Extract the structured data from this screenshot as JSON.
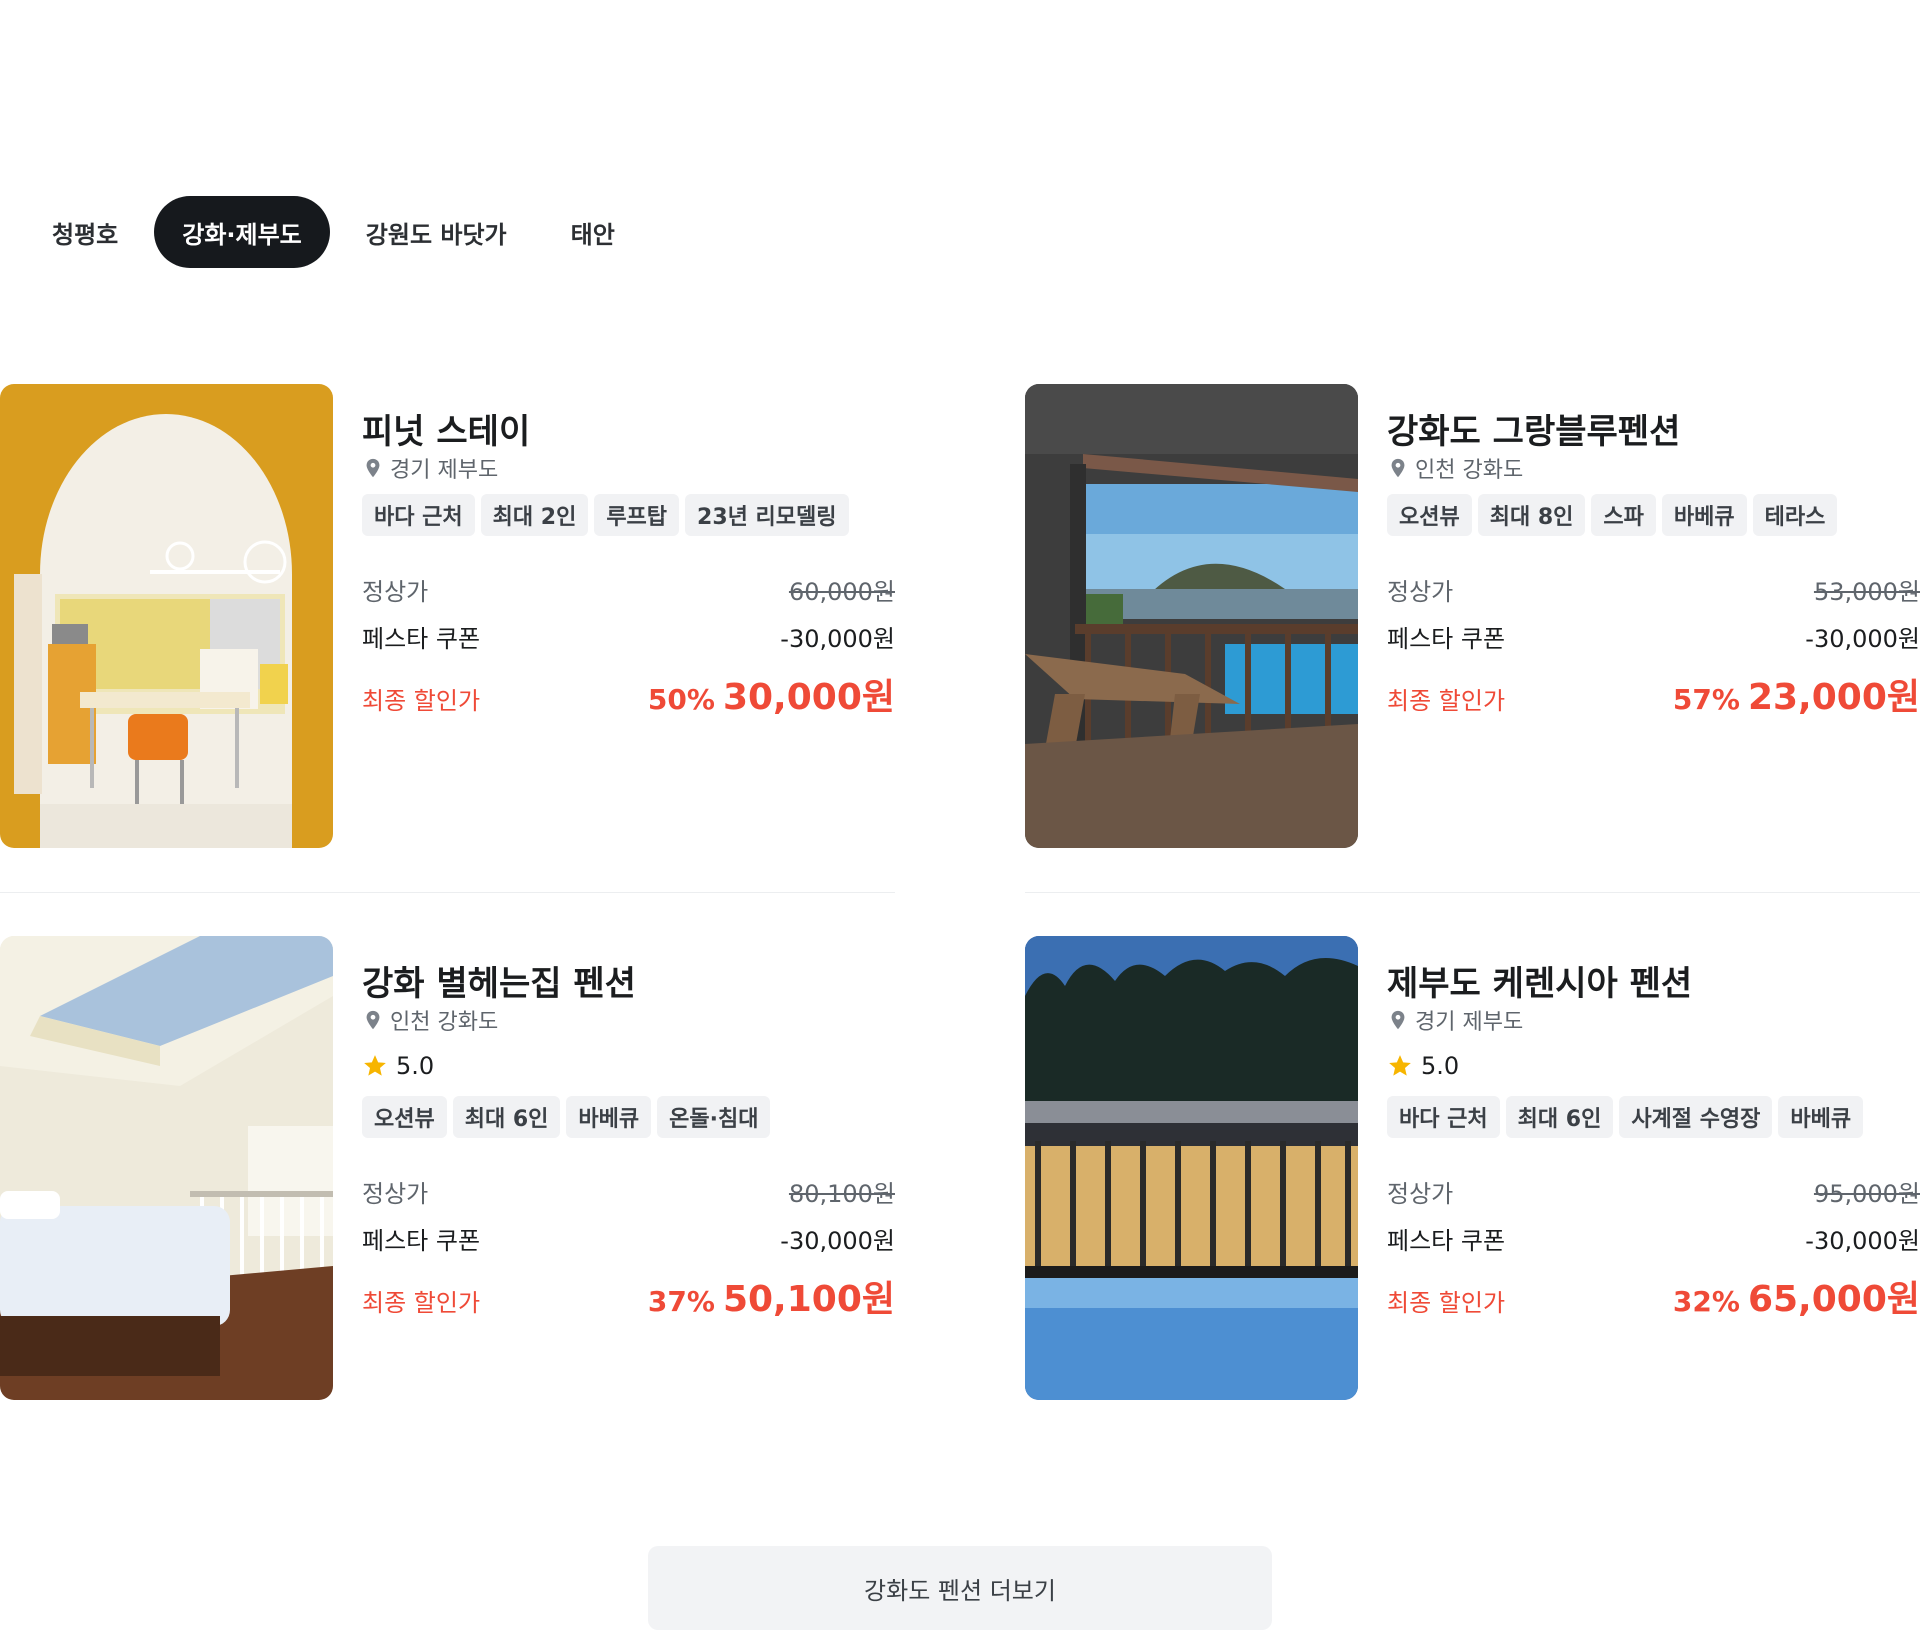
{
  "tabs": [
    "청평호",
    "강화·제부도",
    "강원도 바닷가",
    "태안"
  ],
  "active_tab": 1,
  "price_labels": {
    "regular": "정상가",
    "coupon": "페스타 쿠폰",
    "final": "최종 할인가"
  },
  "listings": [
    {
      "name": "피넛 스테이",
      "location": "경기 제부도",
      "rating": null,
      "tags": [
        "바다 근처",
        "최대 2인",
        "루프탑",
        "23년 리모델링"
      ],
      "regular_price": "60,000원",
      "coupon": "-30,000원",
      "discount_pct": "50%",
      "final_price": "30,000원"
    },
    {
      "name": "강화도 그랑블루펜션",
      "location": "인천 강화도",
      "rating": null,
      "tags": [
        "오션뷰",
        "최대 8인",
        "스파",
        "바베큐",
        "테라스"
      ],
      "regular_price": "53,000원",
      "coupon": "-30,000원",
      "discount_pct": "57%",
      "final_price": "23,000원"
    },
    {
      "name": "강화 별헤는집 펜션",
      "location": "인천 강화도",
      "rating": "5.0",
      "tags": [
        "오션뷰",
        "최대 6인",
        "바베큐",
        "온돌·침대"
      ],
      "regular_price": "80,100원",
      "coupon": "-30,000원",
      "discount_pct": "37%",
      "final_price": "50,100원"
    },
    {
      "name": "제부도 케렌시아 펜션",
      "location": "경기 제부도",
      "rating": "5.0",
      "tags": [
        "바다 근처",
        "최대 6인",
        "사계절 수영장",
        "바베큐"
      ],
      "regular_price": "95,000원",
      "coupon": "-30,000원",
      "discount_pct": "32%",
      "final_price": "65,000원"
    }
  ],
  "more_button": "강화도 펜션 더보기",
  "colors": {
    "accent": "#ef4a37",
    "tab_active_bg": "#16191d",
    "tag_bg": "#f1f2f4",
    "star": "#f7b500"
  },
  "icons": {
    "location": "map-pin-icon",
    "rating": "star-icon"
  }
}
